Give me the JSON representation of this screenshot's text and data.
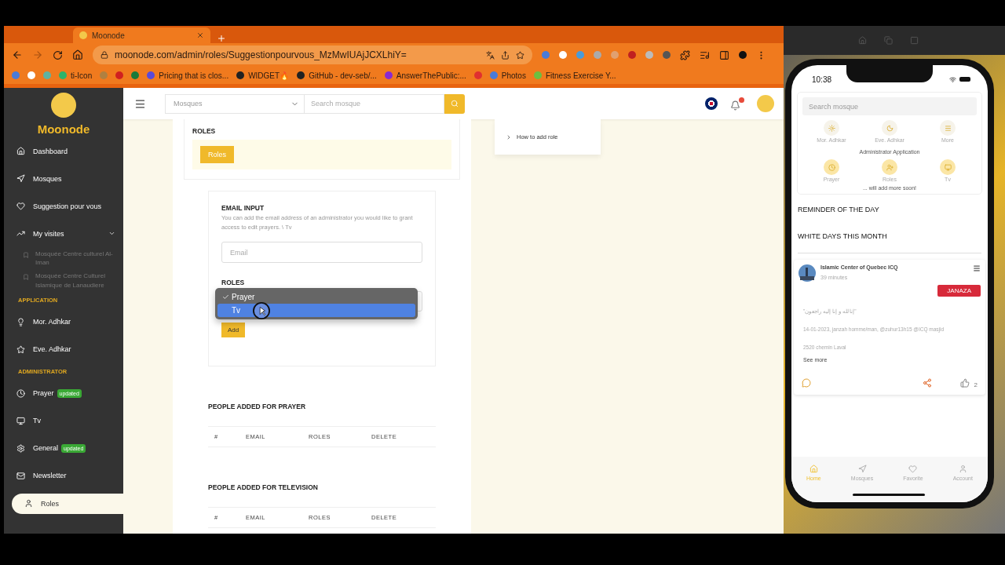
{
  "browser": {
    "tab_title": "Moonode",
    "url": "moonode.com/admin/roles/Suggestionpourvous_MzMwIUAjJCXLhiY=",
    "bookmarks": [
      {
        "kind": "icon",
        "color": "#4a7bd8"
      },
      {
        "kind": "icon",
        "color": "#ffffff"
      },
      {
        "kind": "icon",
        "color": "#5fb3a0"
      },
      {
        "kind": "link",
        "label": "ti-Icon",
        "color": "#2db36a"
      },
      {
        "kind": "icon",
        "color": "#b08040"
      },
      {
        "kind": "icon",
        "color": "#d02020"
      },
      {
        "kind": "icon",
        "color": "#1a7a3a"
      },
      {
        "kind": "link",
        "label": "Pricing that is clos...",
        "color": "#5a4ad8"
      },
      {
        "kind": "link",
        "label": "WIDGET🔥",
        "color": "#222222"
      },
      {
        "kind": "link",
        "label": "GitHub - dev-seb/...",
        "color": "#222222"
      },
      {
        "kind": "link",
        "label": "AnswerThePublic:...",
        "color": "#8a2ad0"
      },
      {
        "kind": "icon",
        "color": "#e03030"
      },
      {
        "kind": "link",
        "label": "Photos",
        "color": "#4a7bd8"
      },
      {
        "kind": "link",
        "label": "Fitness Exercise Y...",
        "color": "#6cc040"
      }
    ]
  },
  "sidebar": {
    "brand": "Moonode",
    "groups": [
      {
        "items": [
          {
            "label": "Dashboard",
            "selected": false
          },
          {
            "label": "Mosques",
            "selected": false
          },
          {
            "label": "Suggestion pour vous",
            "selected": false
          },
          {
            "label": "My visites",
            "selected": false,
            "expanded": true,
            "children": [
              {
                "label": "Mosquée Centre culturel Al-Iman"
              },
              {
                "label": "Mosquée Centre Culturel Islamique de Lanaudiere"
              }
            ]
          }
        ]
      },
      {
        "title": "APPLICATION",
        "items": [
          {
            "label": "Mor. Adhkar",
            "selected": false
          },
          {
            "label": "Eve. Adhkar",
            "selected": false
          }
        ]
      },
      {
        "title": "ADMINISTRATOR",
        "items": [
          {
            "label": "Prayer",
            "selected": false,
            "badge": "updated"
          },
          {
            "label": "Tv",
            "selected": false
          },
          {
            "label": "General",
            "selected": false,
            "badge": "updated"
          },
          {
            "label": "Newsletter",
            "selected": false
          },
          {
            "label": "Roles",
            "selected": true
          }
        ]
      }
    ]
  },
  "header": {
    "select_placeholder": "Mosques",
    "search_placeholder": "Search mosque"
  },
  "roles_card": {
    "title": "ROLES",
    "button": "Roles"
  },
  "help_panel": {
    "items": [
      {
        "label": "How to add role",
        "expanded": false
      }
    ]
  },
  "form": {
    "title": "EMAIL INPUT",
    "description": "You can add the email address of an administrator you would like to grant access to edit prayers. \\ Tv",
    "email_placeholder": "Email",
    "roles_label": "ROLES",
    "options": [
      {
        "label": "Prayer",
        "checked": true,
        "highlighted": false
      },
      {
        "label": "Tv",
        "checked": false,
        "highlighted": true
      }
    ],
    "add_button": "Add"
  },
  "tables": [
    {
      "title": "PEOPLE ADDED FOR PRAYER",
      "columns": [
        "#",
        "EMAIL",
        "ROLES",
        "DELETE"
      ]
    },
    {
      "title": "PEOPLE ADDED FOR TELEVISION",
      "columns": [
        "#",
        "EMAIL",
        "ROLES",
        "DELETE"
      ]
    }
  ],
  "phone": {
    "time": "10:38",
    "search_placeholder": "Search mosque",
    "quick": [
      "Mor. Adhkar",
      "Eve. Adhkar",
      "More"
    ],
    "admin_title": "Administrator Application",
    "admin": [
      "Prayer",
      "Roles",
      "Tv"
    ],
    "admin_note": "... will add more soon!",
    "sections": [
      "REMINDER OF THE DAY",
      "WHITE DAYS THIS MONTH"
    ],
    "post": {
      "author": "Islamic Center of Quebec ICQ",
      "time": "39 minutes",
      "tag": "JANAZA",
      "lines": [
        "\"إنا لله و إنا إليه راجعون\"",
        "14-01-2023, janzah homme/man, @zuhur13h15 @ICQ masjid",
        "2520 chemin Laval"
      ],
      "see_more": "See more",
      "likes": "2"
    },
    "tabs": [
      {
        "label": "Home",
        "selected": true
      },
      {
        "label": "Mosques",
        "selected": false
      },
      {
        "label": "Favorite",
        "selected": false
      },
      {
        "label": "Account",
        "selected": false
      }
    ]
  }
}
